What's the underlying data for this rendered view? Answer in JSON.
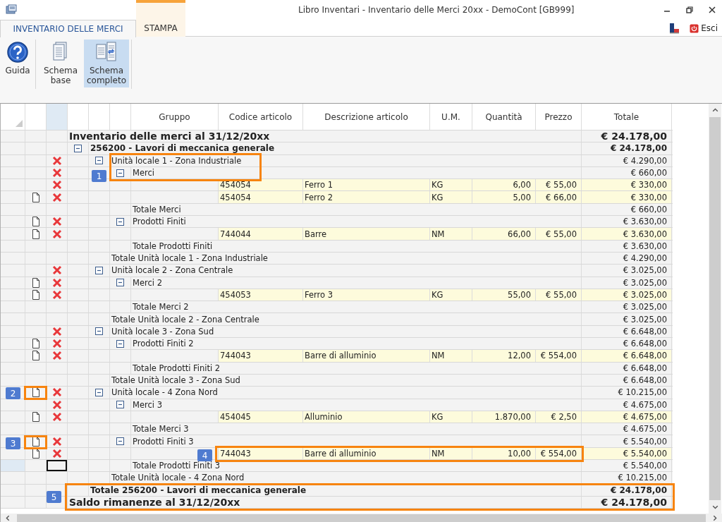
{
  "window": {
    "title": "Libro Inventari - Inventario delle Merci  20xx - DemoCont [GB999]"
  },
  "tabs": [
    {
      "label": "INVENTARIO DELLE MERCI",
      "selected": true,
      "contextual": false
    },
    {
      "label": "STAMPA",
      "selected": false,
      "contextual": true
    }
  ],
  "exit_button": {
    "label": "Esci"
  },
  "ribbon_groups": [
    [
      {
        "label": "Guida",
        "kind": "help",
        "selected": false
      }
    ],
    [
      {
        "label": "Schema base",
        "kind": "pages",
        "selected": false
      },
      {
        "label": "Schema completo",
        "kind": "compare",
        "selected": true
      }
    ]
  ],
  "table": {
    "columns": [
      "Gruppo",
      "Codice articolo",
      "Descrizione articolo",
      "U.M.",
      "Quantità",
      "Prezzo",
      "Totale"
    ],
    "rows": [
      {
        "label": "Inventario delle merci al 31/12/20xx",
        "total": "€ 24.178,00",
        "edit": false,
        "delete": false,
        "footer": {
          "label": "Saldo rimanenze al 31/12/20xx",
          "total": "€ 24.178,00"
        },
        "children": [
          {
            "label": "256200 - Lavori di meccanica generale",
            "total": "€ 24.178,00",
            "expanded": true,
            "edit": false,
            "delete": false,
            "footer": {
              "label": "Totale 256200 - Lavori di meccanica generale",
              "total": "€ 24.178,00"
            },
            "children": [
              {
                "label": "Unità locale 1 - Zona Industriale",
                "total": "€ 4.290,00",
                "expanded": true,
                "edit": false,
                "delete": true,
                "footer": {
                  "label": "Totale Unità locale 1 - Zona Industriale",
                  "total": "€ 4.290,00"
                },
                "children": [
                  {
                    "label": "Merci",
                    "total": "€ 660,00",
                    "expanded": true,
                    "edit": false,
                    "delete": true,
                    "footer": {
                      "label": "Totale Merci",
                      "total": "€ 660,00"
                    },
                    "children": [
                      {
                        "code": "454054",
                        "description": "Ferro 1",
                        "um": "KG",
                        "quantity": "6,00",
                        "price": "€ 55,00",
                        "total": "€ 330,00",
                        "edit": false,
                        "delete": true
                      },
                      {
                        "code": "454054",
                        "description": "Ferro 2",
                        "um": "KG",
                        "quantity": "5,00",
                        "price": "€ 66,00",
                        "total": "€ 330,00",
                        "edit": true,
                        "delete": true
                      }
                    ]
                  },
                  {
                    "label": "Prodotti Finiti",
                    "total": "€ 3.630,00",
                    "expanded": true,
                    "edit": true,
                    "delete": true,
                    "footer": {
                      "label": "Totale Prodotti Finiti",
                      "total": "€ 3.630,00"
                    },
                    "children": [
                      {
                        "code": "744044",
                        "description": "Barre",
                        "um": "NM",
                        "quantity": "66,00",
                        "price": "€ 55,00",
                        "total": "€ 3.630,00",
                        "edit": true,
                        "delete": true
                      }
                    ]
                  }
                ]
              },
              {
                "label": "Unità locale 2 - Zona Centrale",
                "total": "€ 3.025,00",
                "expanded": true,
                "edit": false,
                "delete": true,
                "footer": {
                  "label": "Totale Unità locale 2 - Zona Centrale",
                  "total": "€ 3.025,00"
                },
                "children": [
                  {
                    "label": "Merci 2",
                    "total": "€ 3.025,00",
                    "expanded": true,
                    "edit": true,
                    "delete": true,
                    "footer": {
                      "label": "Totale Merci 2",
                      "total": "€ 3.025,00"
                    },
                    "children": [
                      {
                        "code": "454053",
                        "description": "Ferro 3",
                        "um": "KG",
                        "quantity": "55,00",
                        "price": "€ 55,00",
                        "total": "€ 3.025,00",
                        "edit": true,
                        "delete": true
                      }
                    ]
                  }
                ]
              },
              {
                "label": "Unità locale 3 - Zona Sud",
                "total": "€ 6.648,00",
                "expanded": true,
                "edit": false,
                "delete": true,
                "footer": {
                  "label": "Totale Unità locale 3 - Zona Sud",
                  "total": "€ 6.648,00"
                },
                "children": [
                  {
                    "label": "Prodotti Finiti 2",
                    "total": "€ 6.648,00",
                    "expanded": true,
                    "edit": true,
                    "delete": true,
                    "footer": {
                      "label": "Totale Prodotti Finiti 2",
                      "total": "€ 6.648,00"
                    },
                    "children": [
                      {
                        "code": "744043",
                        "description": "Barre di alluminio",
                        "um": "NM",
                        "quantity": "12,00",
                        "price": "€ 554,00",
                        "total": "€ 6.648,00",
                        "edit": true,
                        "delete": true
                      }
                    ]
                  }
                ]
              },
              {
                "label": "Unità locale - 4 Zona Nord",
                "total": "€ 10.215,00",
                "expanded": true,
                "edit": true,
                "delete": true,
                "footer": {
                  "label": "Totale Unità locale - 4 Zona Nord",
                  "total": "€ 10.215,00"
                },
                "children": [
                  {
                    "label": "Merci 3",
                    "total": "€ 4.675,00",
                    "expanded": true,
                    "edit": false,
                    "delete": true,
                    "footer": {
                      "label": "Totale Merci 3",
                      "total": "€ 4.675,00"
                    },
                    "children": [
                      {
                        "code": "454045",
                        "description": "Alluminio",
                        "um": "KG",
                        "quantity": "1.870,00",
                        "price": "€ 2,50",
                        "total": "€ 4.675,00",
                        "edit": true,
                        "delete": true
                      }
                    ]
                  },
                  {
                    "label": "Prodotti Finiti 3",
                    "total": "€ 5.540,00",
                    "expanded": true,
                    "edit": true,
                    "delete": true,
                    "footer": {
                      "label": "Totale Prodotti Finiti 3",
                      "total": "€ 5.540,00",
                      "cursor": true
                    },
                    "children": [
                      {
                        "code": "744043",
                        "description": "Barre di alluminio",
                        "um": "NM",
                        "quantity": "10,00",
                        "price": "€ 554,00",
                        "total": "€ 5.540,00",
                        "edit": true,
                        "delete": true
                      }
                    ]
                  }
                ]
              }
            ]
          }
        ]
      }
    ]
  },
  "annotations": [
    {
      "label": "1"
    },
    {
      "label": "2"
    },
    {
      "label": "3"
    },
    {
      "label": "4"
    },
    {
      "label": "5"
    }
  ]
}
